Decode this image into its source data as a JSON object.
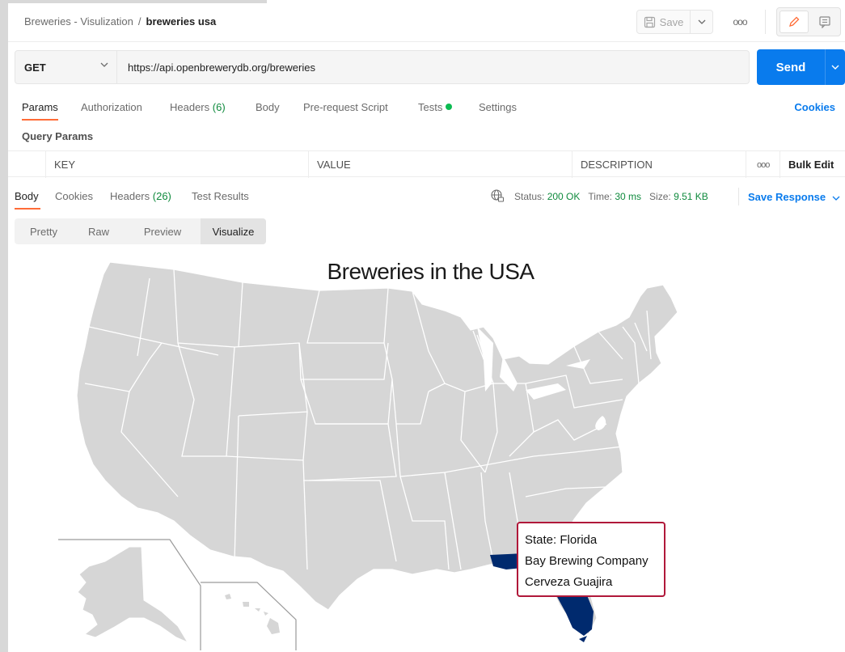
{
  "header": {
    "collection": "Breweries - Visulization",
    "separator": "/",
    "request_name": "breweries usa",
    "save_label": "Save",
    "more_label": "ooo"
  },
  "request": {
    "method": "GET",
    "url": "https://api.openbrewerydb.org/breweries",
    "send_label": "Send"
  },
  "request_tabs": {
    "params": "Params",
    "authorization": "Authorization",
    "headers": "Headers",
    "headers_count": "(6)",
    "body": "Body",
    "prerequest": "Pre-request Script",
    "tests": "Tests",
    "settings": "Settings",
    "cookies": "Cookies"
  },
  "query_params": {
    "label": "Query Params",
    "columns": [
      "KEY",
      "VALUE",
      "DESCRIPTION"
    ],
    "more_label": "ooo",
    "bulk_edit": "Bulk Edit"
  },
  "response_tabs": {
    "body": "Body",
    "cookies": "Cookies",
    "headers": "Headers",
    "headers_count": "(26)",
    "test_results": "Test Results"
  },
  "response_meta": {
    "status_label": "Status:",
    "status_value": "200 OK",
    "time_label": "Time:",
    "time_value": "30 ms",
    "size_label": "Size:",
    "size_value": "9.51 KB",
    "save_response": "Save Response"
  },
  "view_modes": {
    "pretty": "Pretty",
    "raw": "Raw",
    "preview": "Preview",
    "visualize": "Visualize"
  },
  "visualization": {
    "title": "Breweries in the USA",
    "highlight_color": "#002a6e",
    "state_color": "#d6d6d6",
    "tooltip": {
      "state": "State: Florida",
      "brewery_1": "Bay Brewing Company",
      "brewery_2": "Cerveza Guajira"
    }
  },
  "colors": {
    "accent": "#ff6c37",
    "primary": "#097bed",
    "success": "#0f8a3d"
  }
}
